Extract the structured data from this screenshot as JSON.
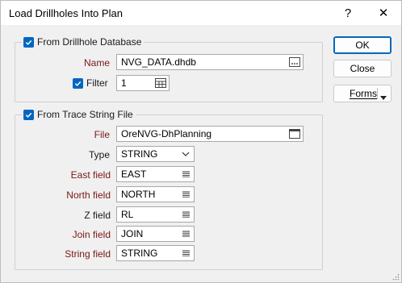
{
  "window": {
    "title": "Load Drillholes Into Plan",
    "help_label": "?",
    "close_label": "✕"
  },
  "drillhole_group": {
    "checked": true,
    "label": "From Drillhole Database",
    "name_label": "Name",
    "name_value": "NVG_DATA.dhdb",
    "filter_checked": true,
    "filter_label": "Filter",
    "filter_value": "1"
  },
  "trace_group": {
    "checked": true,
    "label": "From Trace String File",
    "file_label": "File",
    "file_value": "OreNVG-DhPlanning",
    "type_label": "Type",
    "type_value": "STRING",
    "fields": [
      {
        "label": "East field",
        "value": "EAST",
        "required": true
      },
      {
        "label": "North field",
        "value": "NORTH",
        "required": true
      },
      {
        "label": "Z field",
        "value": "RL",
        "required": false
      },
      {
        "label": "Join field",
        "value": "JOIN",
        "required": true
      },
      {
        "label": "String field",
        "value": "STRING",
        "required": true
      }
    ]
  },
  "buttons": {
    "ok": "OK",
    "close": "Close",
    "forms": "Forms"
  },
  "colors": {
    "accent": "#0067c0",
    "required_label": "#7a1818"
  }
}
